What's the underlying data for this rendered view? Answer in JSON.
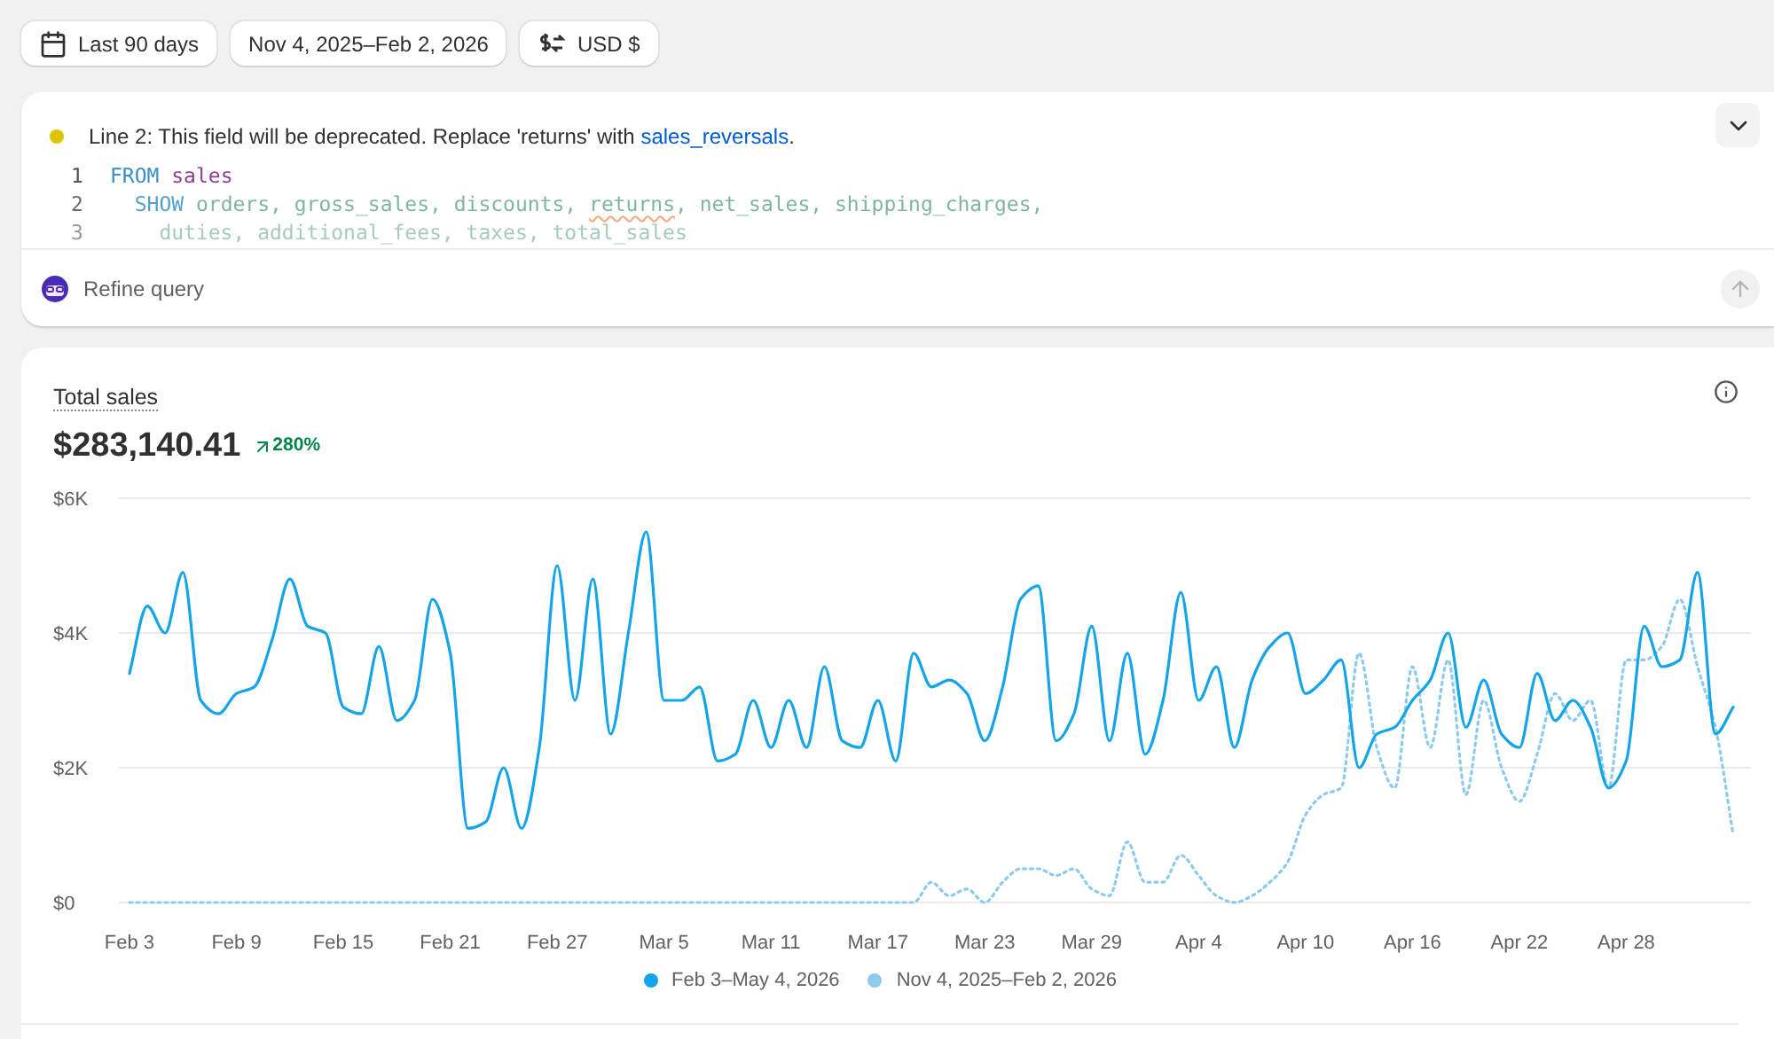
{
  "filters": [
    {
      "kind": "calendar",
      "label": "Last 90 days"
    },
    {
      "kind": "plain",
      "label": "Nov 4, 2025–Feb 2, 2026"
    },
    {
      "kind": "currency",
      "label": "USD $"
    }
  ],
  "query": {
    "notice": {
      "color": "#e0c200",
      "text": "Line 2: This field will be deprecated. Replace 'returns' with ",
      "link": "sales_reversals",
      "end": "."
    },
    "lines": [
      {
        "number": "1",
        "tokens": [
          {
            "kind": "keyword",
            "text": "FROM"
          },
          {
            "kind": "table",
            "text": " sales"
          }
        ]
      },
      {
        "number": "2",
        "tokens": [
          {
            "kind": "keyword",
            "text": "  SHOW"
          },
          {
            "kind": "field",
            "text": " orders, gross_sales, discounts, "
          },
          {
            "kind": "flagged",
            "text": "returns"
          },
          {
            "kind": "field",
            "text": ", net_sales, shipping_charges,"
          }
        ]
      },
      {
        "number": "3",
        "tokens": [
          {
            "kind": "field",
            "text": "    duties, additional_fees, taxes, total_sales"
          }
        ]
      }
    ],
    "prompt_placeholder": "Refine query"
  },
  "metric": {
    "title": "Total sales",
    "value": "$283,140.41",
    "change": "280%",
    "chart_data": {
      "type": "line",
      "ylim": [
        0,
        6000
      ],
      "yticks": [
        {
          "value": 0,
          "label": "$0"
        },
        {
          "value": 2000,
          "label": "$2K"
        },
        {
          "value": 4000,
          "label": "$4K"
        },
        {
          "value": 6000,
          "label": "$6K"
        }
      ],
      "categories": [
        "Feb 3",
        null,
        null,
        null,
        null,
        null,
        "Feb 9",
        null,
        null,
        null,
        null,
        null,
        "Feb 15",
        null,
        null,
        null,
        null,
        null,
        "Feb 21",
        null,
        null,
        null,
        null,
        null,
        "Feb 27",
        null,
        null,
        null,
        null,
        null,
        "Mar 5",
        null,
        null,
        null,
        null,
        null,
        "Mar 11",
        null,
        null,
        null,
        null,
        null,
        "Mar 17",
        null,
        null,
        null,
        null,
        null,
        "Mar 23",
        null,
        null,
        null,
        null,
        null,
        "Mar 29",
        null,
        null,
        null,
        null,
        null,
        "Apr 4",
        null,
        null,
        null,
        null,
        null,
        "Apr 10",
        null,
        null,
        null,
        null,
        null,
        "Apr 16",
        null,
        null,
        null,
        null,
        null,
        "Apr 22",
        null,
        null,
        null,
        null,
        null,
        "Apr 28",
        null,
        null,
        null,
        null,
        null,
        null
      ],
      "legend": "bottom",
      "series": [
        {
          "name": "Feb 3–May 4, 2026",
          "color": "#13a5e8",
          "line_style": "solid",
          "values": [
            3400,
            4400,
            4000,
            4900,
            3000,
            2800,
            3100,
            3200,
            3900,
            4800,
            4100,
            4000,
            2900,
            2800,
            3800,
            2700,
            3000,
            4500,
            3700,
            1100,
            1200,
            2000,
            1100,
            2300,
            5000,
            3000,
            4800,
            2500,
            4000,
            5500,
            3000,
            3000,
            3200,
            2100,
            2200,
            3000,
            2300,
            3000,
            2300,
            3500,
            2400,
            2300,
            3000,
            2100,
            3700,
            3200,
            3300,
            3100,
            2400,
            3200,
            4500,
            4700,
            2400,
            2800,
            4100,
            2400,
            3700,
            2200,
            3000,
            4600,
            3000,
            3500,
            2300,
            3300,
            3800,
            4000,
            3100,
            3300,
            3600,
            2000,
            2500,
            2600,
            3000,
            3300,
            4000,
            2600,
            3300,
            2500,
            2300,
            3400,
            2700,
            3000,
            2600,
            1700,
            2100,
            4100,
            3500,
            3600,
            4900,
            2500,
            2900
          ]
        },
        {
          "name": "Nov 4, 2025–Feb 2, 2026",
          "color": "#8ccbed",
          "line_style": "dashed",
          "values": [
            0,
            0,
            0,
            0,
            0,
            0,
            0,
            0,
            0,
            0,
            0,
            0,
            0,
            0,
            0,
            0,
            0,
            0,
            0,
            0,
            0,
            0,
            0,
            0,
            0,
            0,
            0,
            0,
            0,
            0,
            0,
            0,
            0,
            0,
            0,
            0,
            0,
            0,
            0,
            0,
            0,
            0,
            0,
            0,
            0,
            300,
            100,
            200,
            0,
            300,
            500,
            500,
            400,
            500,
            200,
            100,
            900,
            300,
            300,
            700,
            400,
            100,
            0,
            100,
            300,
            600,
            1300,
            1600,
            1700,
            3700,
            2300,
            1700,
            3500,
            2300,
            3600,
            1600,
            3000,
            2000,
            1500,
            2200,
            3100,
            2700,
            3000,
            1700,
            3600,
            3600,
            3800,
            4500,
            3500,
            2600,
            1000
          ]
        }
      ]
    }
  }
}
